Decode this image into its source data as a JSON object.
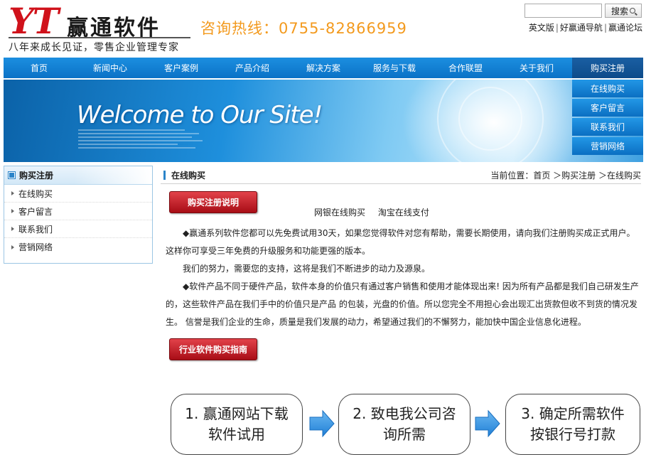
{
  "header": {
    "logo_letters": "YT",
    "logo_name": "赢通软件",
    "slogan": "八年来成长见证，零售企业管理专家",
    "hotline": "咨询热线：0755-82866959",
    "search_button": "搜索",
    "top_links": [
      "英文版",
      "好赢通导航",
      "赢通论坛"
    ]
  },
  "nav": {
    "items": [
      "首页",
      "新闻中心",
      "客户案例",
      "产品介绍",
      "解决方案",
      "服务与下载",
      "合作联盟",
      "关于我们",
      "购买注册"
    ]
  },
  "dropdown": {
    "items": [
      "在线购买",
      "客户留言",
      "联系我们",
      "营销网络"
    ]
  },
  "banner": {
    "welcome": "Welcome to Our Site!"
  },
  "sidebar": {
    "title": "购买注册",
    "items": [
      "在线购买",
      "客户留言",
      "联系我们",
      "营销网络"
    ]
  },
  "main": {
    "title": "在线购买",
    "breadcrumb": "当前位置：首页 ＞购买注册 ＞在线购买",
    "button1": "购买注册说明",
    "pay_links": [
      "网银在线购买",
      "淘宝在线支付"
    ],
    "para1": "◆赢通系列软件您都可以先免费试用30天，如果您觉得软件对您有帮助，需要长期使用，请向我们注册购买成正式用户。这样你可享受三年免费的升级服务和功能更强的版本。",
    "para2": "我们的努力，需要您的支持，这将是我们不断进步的动力及源泉。",
    "para3": "◆软件产品不同于硬件产品，软件本身的价值只有通过客户销售和使用才能体现出来! 因为所有产品都是我们自己研发生产的，这些软件产品在我们手中的价值只是产品 的包装，光盘的价值。所以您完全不用担心会出现汇出货款但收不到货的情况发生。 信誉是我们企业的生命，质量是我们发展的动力，希望通过我们的不懈努力，能加快中国企业信息化进程。",
    "button2": "行业软件购买指南"
  },
  "flow": {
    "steps": [
      "1. 赢通网站下载软件试用",
      "2. 致电我公司咨询所需",
      "3. 确定所需软件按银行号打款"
    ]
  },
  "colors": {
    "nav_blue": "#0a72c6",
    "logo_red": "#d0121b",
    "hotline_orange": "#f39a1e",
    "button_red": "#c0202a",
    "arrow_blue": "#2a8be0"
  }
}
